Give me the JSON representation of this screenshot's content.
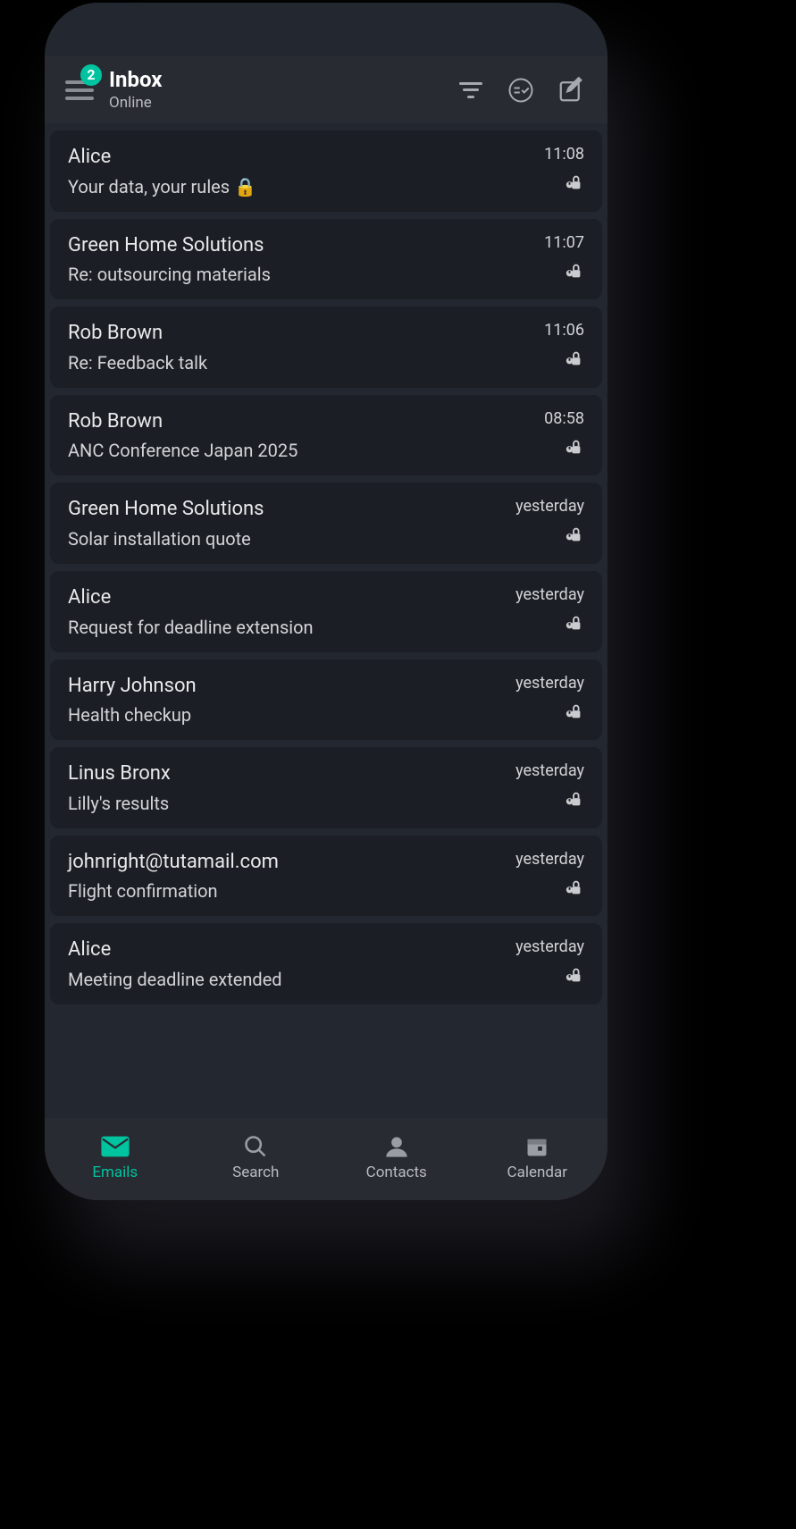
{
  "header": {
    "title": "Inbox",
    "subtitle": "Online",
    "badge": "2"
  },
  "emails": [
    {
      "sender": "Alice",
      "subject": "Your data, your rules 🔒",
      "time": "11:08"
    },
    {
      "sender": "Green Home Solutions",
      "subject": "Re: outsourcing materials",
      "time": "11:07"
    },
    {
      "sender": "Rob Brown",
      "subject": "Re: Feedback talk",
      "time": "11:06"
    },
    {
      "sender": "Rob Brown",
      "subject": "ANC Conference Japan 2025",
      "time": "08:58"
    },
    {
      "sender": "Green Home Solutions",
      "subject": "Solar installation quote",
      "time": "yesterday"
    },
    {
      "sender": "Alice",
      "subject": "Request for deadline extension",
      "time": "yesterday"
    },
    {
      "sender": "Harry Johnson",
      "subject": "Health checkup",
      "time": "yesterday"
    },
    {
      "sender": "Linus Bronx",
      "subject": "Lilly's results",
      "time": "yesterday"
    },
    {
      "sender": "johnright@tutamail.com",
      "subject": "Flight confirmation",
      "time": "yesterday"
    },
    {
      "sender": "Alice",
      "subject": "Meeting deadline extended",
      "time": "yesterday"
    }
  ],
  "nav": {
    "emails": "Emails",
    "search": "Search",
    "contacts": "Contacts",
    "calendar": "Calendar"
  },
  "colors": {
    "accent": "#00c3a0"
  }
}
